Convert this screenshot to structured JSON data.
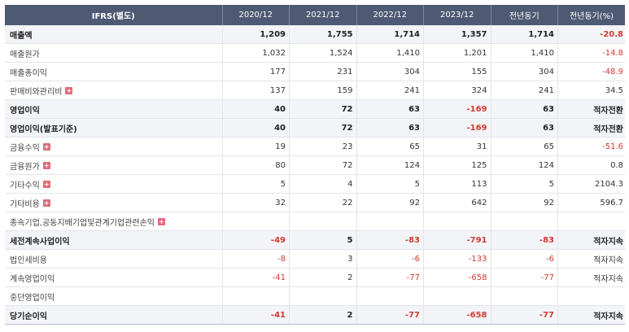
{
  "header": [
    "IFRS(별도)",
    "2020/12",
    "2021/12",
    "2022/12",
    "2023/12",
    "전년동기",
    "전년동기(%)"
  ],
  "rows": [
    {
      "label": "매출액",
      "bold": true,
      "hl": true,
      "plus": false,
      "values": [
        "1,209",
        "1,755",
        "1,714",
        "1,357",
        "1,714",
        "-20.8"
      ]
    },
    {
      "label": "매출원가",
      "bold": false,
      "hl": false,
      "plus": false,
      "values": [
        "1,032",
        "1,524",
        "1,410",
        "1,201",
        "1,410",
        "-14.8"
      ]
    },
    {
      "label": "매출총이익",
      "bold": false,
      "hl": false,
      "plus": false,
      "values": [
        "177",
        "231",
        "304",
        "155",
        "304",
        "-48.9"
      ]
    },
    {
      "label": "판매비와관리비",
      "bold": false,
      "hl": false,
      "plus": true,
      "values": [
        "137",
        "159",
        "241",
        "324",
        "241",
        "34.5"
      ]
    },
    {
      "label": "영업이익",
      "bold": true,
      "hl": true,
      "plus": false,
      "values": [
        "40",
        "72",
        "63",
        "-169",
        "63",
        "적자전환"
      ]
    },
    {
      "label": "영업이익(발표기준)",
      "bold": true,
      "hl": true,
      "plus": false,
      "values": [
        "40",
        "72",
        "63",
        "-169",
        "63",
        "적자전환"
      ]
    },
    {
      "label": "금융수익",
      "bold": false,
      "hl": false,
      "plus": true,
      "values": [
        "19",
        "23",
        "65",
        "31",
        "65",
        "-51.6"
      ]
    },
    {
      "label": "금융원가",
      "bold": false,
      "hl": false,
      "plus": true,
      "values": [
        "80",
        "72",
        "124",
        "125",
        "124",
        "0.8"
      ]
    },
    {
      "label": "기타수익",
      "bold": false,
      "hl": false,
      "plus": true,
      "values": [
        "5",
        "4",
        "5",
        "113",
        "5",
        "2104.3"
      ]
    },
    {
      "label": "기타비용",
      "bold": false,
      "hl": false,
      "plus": true,
      "values": [
        "32",
        "22",
        "92",
        "642",
        "92",
        "596.7"
      ]
    },
    {
      "label": "종속기업,공동지배기업및관계기업관련손익",
      "bold": false,
      "hl": false,
      "plus": true,
      "values": [
        "",
        "",
        "",
        "",
        "",
        ""
      ]
    },
    {
      "label": "세전계속사업이익",
      "bold": true,
      "hl": true,
      "plus": false,
      "values": [
        "-49",
        "5",
        "-83",
        "-791",
        "-83",
        "적자지속"
      ]
    },
    {
      "label": "법인세비용",
      "bold": false,
      "hl": false,
      "plus": false,
      "values": [
        "-8",
        "3",
        "-6",
        "-133",
        "-6",
        "적자지속"
      ]
    },
    {
      "label": "계속영업이익",
      "bold": false,
      "hl": false,
      "plus": false,
      "values": [
        "-41",
        "2",
        "-77",
        "-658",
        "-77",
        "적자지속"
      ]
    },
    {
      "label": "중단영업이익",
      "bold": false,
      "hl": false,
      "plus": false,
      "values": [
        "",
        "",
        "",
        "",
        "",
        ""
      ]
    },
    {
      "label": "당기순이익",
      "bold": true,
      "hl": true,
      "plus": false,
      "values": [
        "-41",
        "2",
        "-77",
        "-658",
        "-77",
        "적자지속"
      ]
    }
  ],
  "colors": {
    "header_bg": "#4e5a73",
    "negative": "#d13b2f",
    "plus_icon": "#e06a79",
    "highlight_row": "#f3f4f8"
  }
}
